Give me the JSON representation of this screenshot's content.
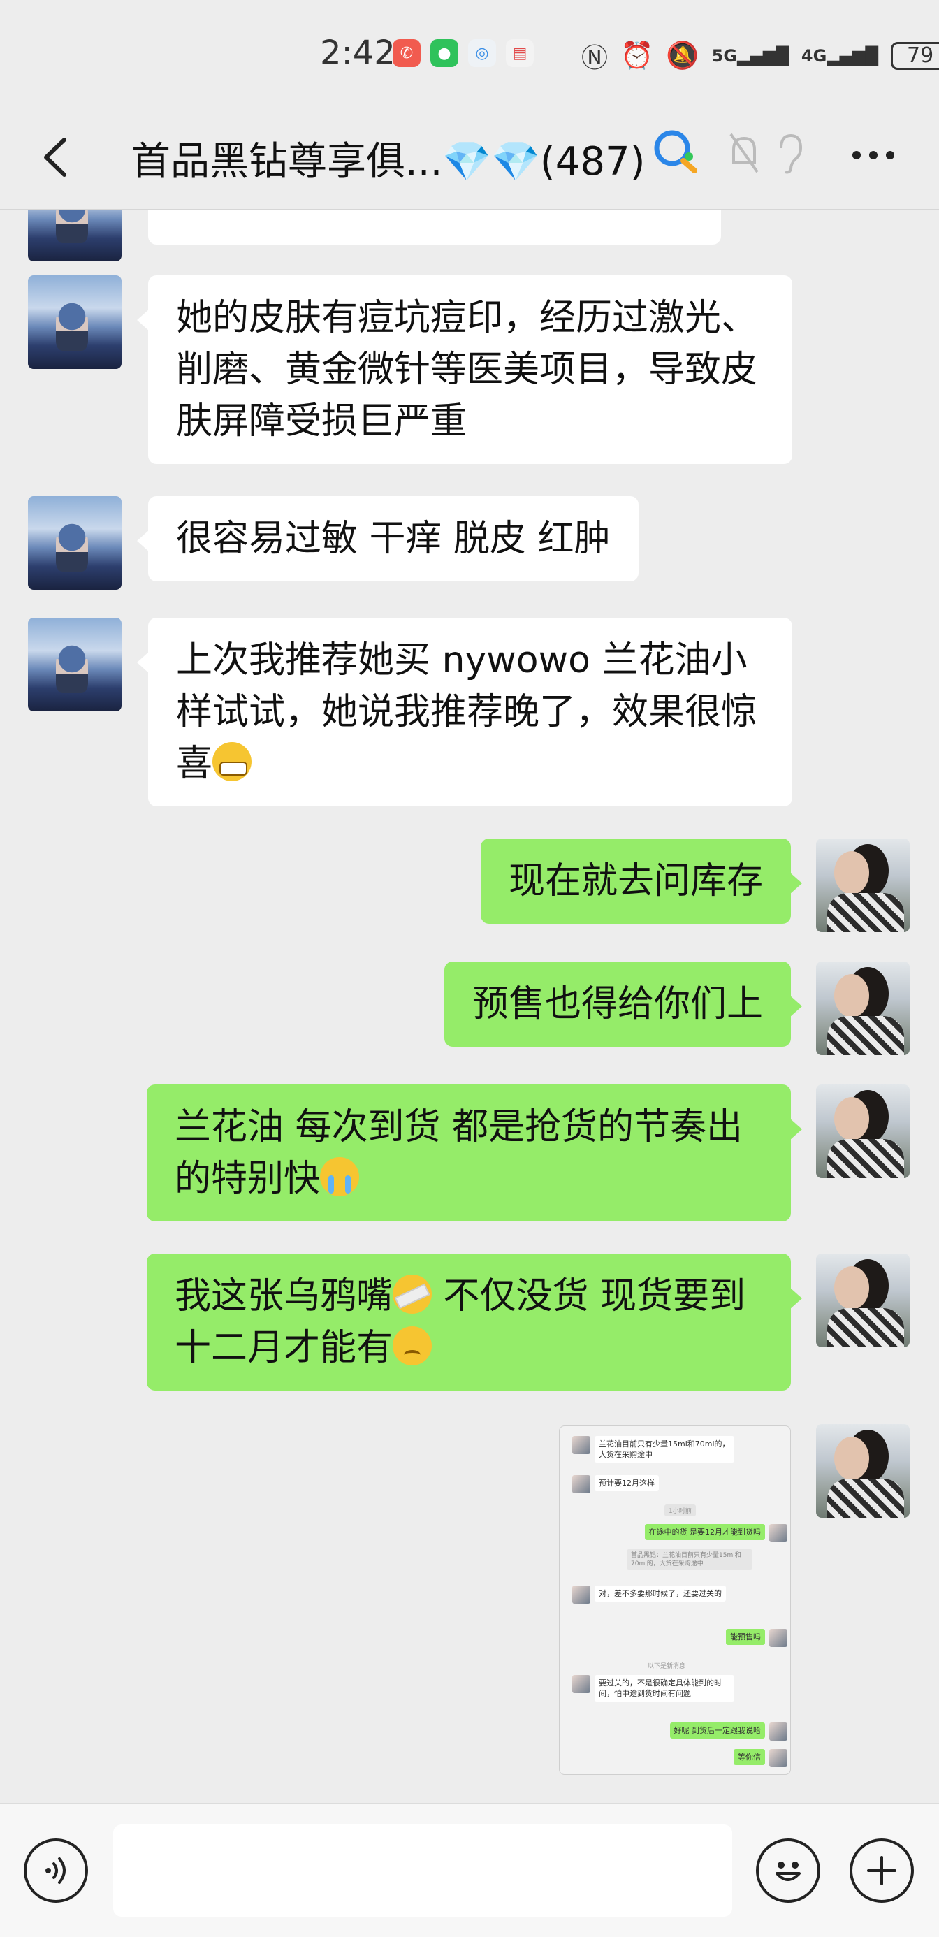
{
  "status_bar": {
    "time": "2:42",
    "network_5g": "5G",
    "network_4g": "4G",
    "battery": "79"
  },
  "header": {
    "title": "首品黑钻尊享俱...💎💎(487)"
  },
  "messages": [
    {
      "side": "left",
      "text": "她的皮肤有痘坑痘印，经历过激光、削磨、黄金微针等医美项目，导致皮肤屏障受损巨严重"
    },
    {
      "side": "left",
      "text": "很容易过敏 干痒 脱皮 红肿"
    },
    {
      "side": "left",
      "text_before": "上次我推荐她买 nywowo 兰花油小样试试，她说我推荐晚了，效果很惊喜",
      "emoji": "grin-emoji"
    },
    {
      "side": "right",
      "text": "现在就去问库存"
    },
    {
      "side": "right",
      "text": "预售也得给你们上"
    },
    {
      "side": "right",
      "text_before": "兰花油 每次到货 都是抢货的节奏出的特别快",
      "emoji": "cry-emoji"
    },
    {
      "side": "right",
      "text_before": "我这张乌鸦嘴",
      "text_middle": " 不仅没货 现货要到十二月才能有",
      "emoji1": "tape-mouth-emoji",
      "emoji2": "sad-emoji"
    }
  ],
  "screenshot_message": {
    "rows": [
      {
        "side": "left",
        "text": "兰花油目前只有少量15ml和70ml的，大货在采购途中"
      },
      {
        "side": "left",
        "text": "预计要12月这样"
      },
      {
        "side": "note",
        "text": "1小时前"
      },
      {
        "side": "right",
        "text": "在途中的货 是要12月才能到货吗"
      },
      {
        "side": "quote",
        "text": "首品黑钻：兰花油目前只有少量15ml和70ml的，大货在采购途中"
      },
      {
        "side": "left",
        "text": "对，差不多要那时候了，还要过关的"
      },
      {
        "side": "right",
        "text": "能预售吗"
      },
      {
        "side": "note",
        "text": "以下是新消息"
      },
      {
        "side": "left",
        "text": "要过关的，不是很确定具体能到的时间，怕中途到货时间有问题"
      },
      {
        "side": "right",
        "text": "好呢 到货后一定跟我说哈"
      },
      {
        "side": "right",
        "text": "等你信"
      }
    ]
  },
  "colors": {
    "bg": "#ededed",
    "bubble_self": "#95ec69",
    "bubble_other": "#ffffff"
  },
  "icons": [
    "back-icon",
    "search-icon",
    "mute-icon",
    "ear-icon",
    "more-icon",
    "voice-icon",
    "emoji-icon",
    "plus-icon"
  ]
}
